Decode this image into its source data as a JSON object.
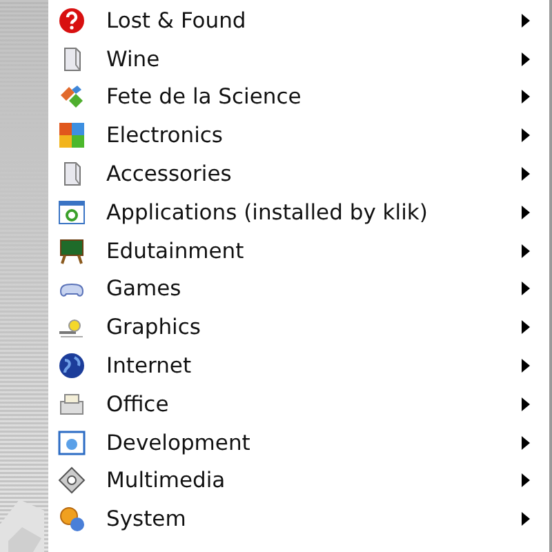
{
  "menu": {
    "items": [
      {
        "label": "Lost & Found",
        "submenu": true
      },
      {
        "label": "Wine",
        "submenu": true
      },
      {
        "label": "Fete de la Science",
        "submenu": true
      },
      {
        "label": "Electronics",
        "submenu": true
      },
      {
        "label": "Accessories",
        "submenu": true
      },
      {
        "label": "Applications (installed by klik)",
        "submenu": true
      },
      {
        "label": "Edutainment",
        "submenu": true
      },
      {
        "label": "Games",
        "submenu": true
      },
      {
        "label": "Graphics",
        "submenu": true
      },
      {
        "label": "Internet",
        "submenu": true
      },
      {
        "label": "Office",
        "submenu": true
      },
      {
        "label": "Development",
        "submenu": true
      },
      {
        "label": "Multimedia",
        "submenu": true
      },
      {
        "label": "System",
        "submenu": true
      }
    ]
  }
}
